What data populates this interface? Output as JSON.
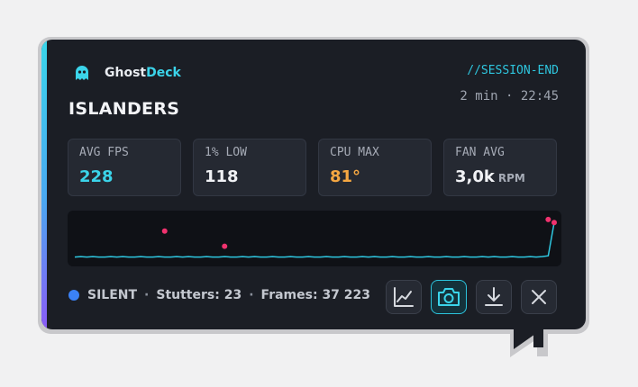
{
  "brand": {
    "name_part1": "Ghost",
    "name_part2": "Deck"
  },
  "session": {
    "tag": "//SESSION-END",
    "duration_time": "2 min · 22:45"
  },
  "game": {
    "title": "ISLANDERS"
  },
  "stats": [
    {
      "label": "AVG FPS",
      "value": "228",
      "unit": "",
      "color": "#3bd4ea"
    },
    {
      "label": "1% LOW",
      "value": "118",
      "unit": "",
      "color": "#f1f2f5"
    },
    {
      "label": "CPU MAX",
      "value": "81°",
      "unit": "",
      "color": "#f5a742"
    },
    {
      "label": "FAN AVG",
      "value": "3,0k",
      "unit": "RPM",
      "color": "#f1f2f5"
    }
  ],
  "footer": {
    "mode": "SILENT",
    "mode_color": "#3b82f6",
    "stutters": "Stutters: 23",
    "frames": "Frames: 37 223"
  },
  "actions": [
    {
      "name": "chart-icon",
      "active": false
    },
    {
      "name": "camera-icon",
      "active": true
    },
    {
      "name": "download-icon",
      "active": false
    },
    {
      "name": "close-icon",
      "active": false
    }
  ],
  "colors": {
    "accent": "#3bd4ea",
    "stutter_marker": "#f0326e",
    "line": "#2ec6df",
    "warn": "#f5a742"
  },
  "chart_data": {
    "type": "line",
    "series": [
      {
        "values": [
          0.05,
          0.06,
          0.05,
          0.06,
          0.05,
          0.05,
          0.06,
          0.05,
          0.06,
          0.05,
          0.05,
          0.06,
          0.05,
          0.05,
          0.06,
          0.05,
          0.05,
          0.06,
          0.05,
          0.06,
          0.05,
          0.05,
          0.06,
          0.05,
          0.05,
          0.06,
          0.05,
          0.05,
          0.06,
          0.05,
          0.06,
          0.05,
          0.05,
          0.06,
          0.05,
          0.05,
          0.06,
          0.05,
          0.05,
          0.06,
          0.05,
          0.05,
          0.06,
          0.05,
          0.05,
          0.06,
          0.05,
          0.05,
          0.06,
          0.05,
          0.06,
          0.05,
          0.05,
          0.06,
          0.05,
          0.05,
          0.06,
          0.05,
          0.05,
          0.06,
          0.05,
          0.05,
          0.06,
          0.05,
          0.05,
          0.06,
          0.05,
          0.05,
          0.06,
          0.05,
          0.06,
          0.05,
          0.05,
          0.06,
          0.05,
          0.05,
          0.06,
          0.05,
          0.06,
          0.08,
          0.85
        ]
      }
    ],
    "markers": [
      {
        "index": 15,
        "value": 0.65
      },
      {
        "index": 25,
        "value": 0.3
      },
      {
        "index": 79,
        "value": 0.92
      },
      {
        "index": 80,
        "value": 0.85
      }
    ]
  }
}
